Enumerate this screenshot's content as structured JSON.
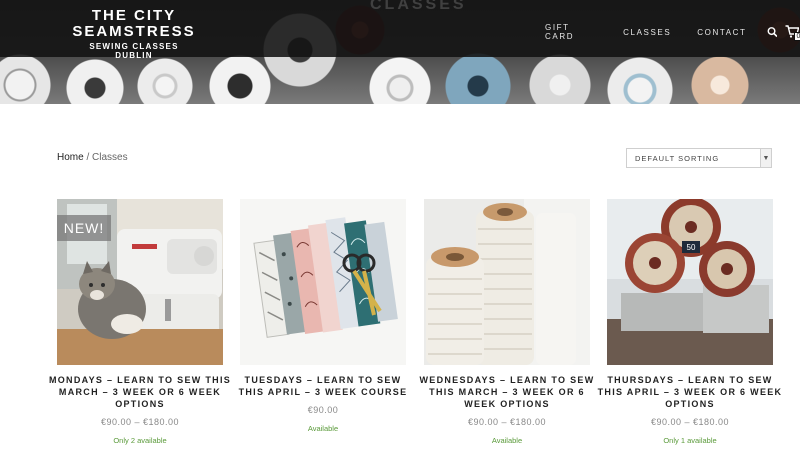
{
  "header": {
    "ghost_title": "CLASSES",
    "logo": {
      "line1": "THE CITY",
      "line2": "SEAMSTRESS",
      "tagline": "SEWING CLASSES DUBLIN"
    },
    "nav": [
      "GIFT CARD",
      "CLASSES",
      "CONTACT"
    ],
    "cart_count": "0",
    "search_icon": "search-icon",
    "cart_icon": "cart-icon"
  },
  "breadcrumb": {
    "home": "Home",
    "separator": " / ",
    "current": "Classes"
  },
  "sort": {
    "selected": "DEFAULT SORTING"
  },
  "products": [
    {
      "badge": "NEW!",
      "title": "MONDAYS – LEARN TO SEW THIS MARCH – 3 WEEK OR 6 WEEK OPTIONS",
      "price": "€90.00 – €180.00",
      "stock": "Only 2 available"
    },
    {
      "title": "TUESDAYS – LEARN TO SEW THIS APRIL – 3 WEEK COURSE",
      "price": "€90.00",
      "stock": "Available"
    },
    {
      "title": "WEDNESDAYS – LEARN TO SEW THIS MARCH – 3 WEEK OR 6 WEEK OPTIONS",
      "price": "€90.00 – €180.00",
      "stock": "Available"
    },
    {
      "title": "THURSDAYS – LEARN TO SEW THIS APRIL – 3 WEEK OR 6 WEEK OPTIONS",
      "price": "€90.00 – €180.00",
      "stock": "Only 1 available"
    }
  ],
  "colors": {
    "header_bg": "#121212",
    "stock_green": "#5a9a3a",
    "price_gray": "#888888"
  }
}
